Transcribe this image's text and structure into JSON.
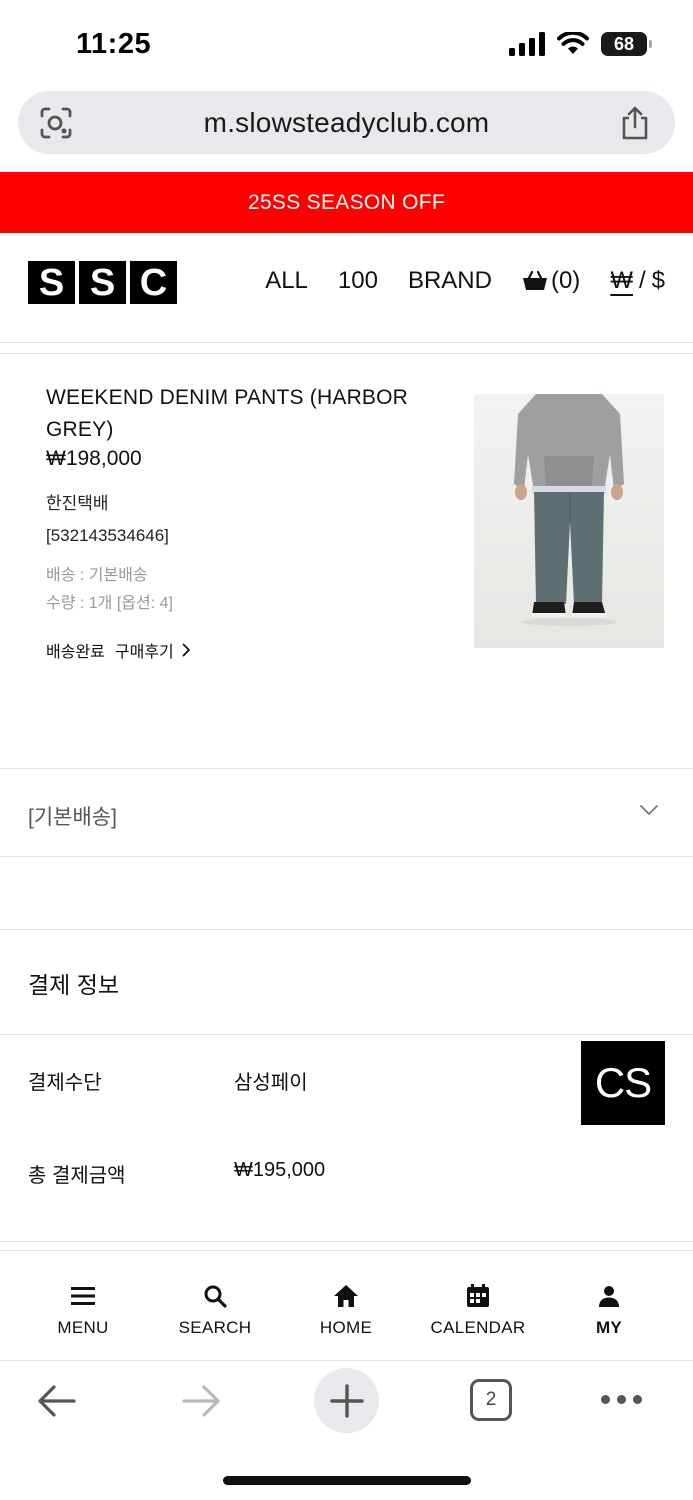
{
  "status_bar": {
    "time": "11:25",
    "battery": "68"
  },
  "browser": {
    "url": "m.slowsteadyclub.com",
    "tab_count": "2"
  },
  "promo_banner": "25SS SEASON OFF",
  "header": {
    "logo_letters": [
      "S",
      "S",
      "C"
    ],
    "nav": {
      "all": "ALL",
      "hundred": "100",
      "brand": "BRAND",
      "cart_count": "(0)",
      "currency_won": "₩",
      "currency_sep": "/",
      "currency_usd": "$"
    }
  },
  "order_item": {
    "name": "WEEKEND DENIM PANTS (HARBOR GREY)",
    "price": "₩198,000",
    "courier": "한진택배",
    "tracking": "[532143534646]",
    "shipping_type": "배송 : 기본배송",
    "quantity": "수량 : 1개 [옵션: 4]",
    "status": "배송완료",
    "review_link": "구매후기"
  },
  "shipping_section": {
    "label": "[기본배송]"
  },
  "payment": {
    "title": "결제 정보",
    "method_label": "결제수단",
    "method_value": "삼성페이",
    "total_label": "총 결제금액",
    "total_value": "₩195,000",
    "cs_badge": "CS"
  },
  "bottom_nav": {
    "menu": "MENU",
    "search": "SEARCH",
    "home": "HOME",
    "calendar": "CALENDAR",
    "my": "MY"
  },
  "colors": {
    "promo_bg": "#ff0000",
    "text": "#111111",
    "muted": "#999999",
    "url_bar_bg": "#e8e9ec"
  }
}
